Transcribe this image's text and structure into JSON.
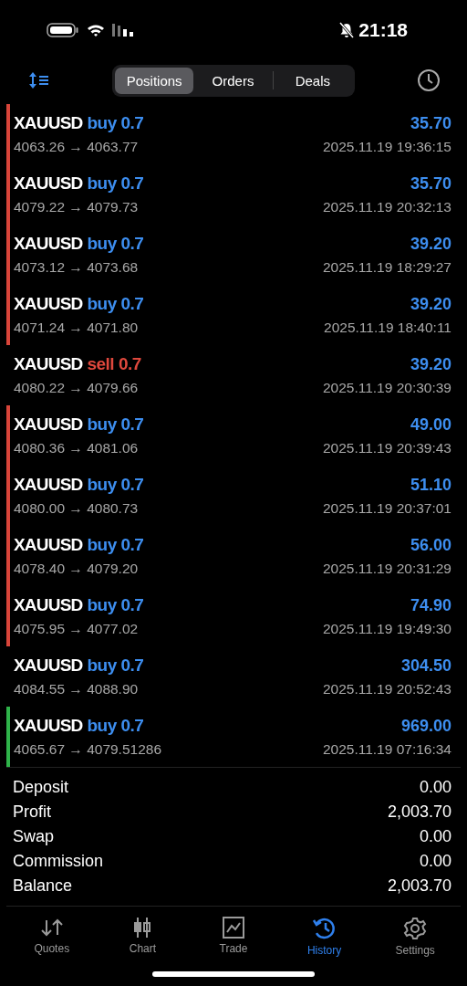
{
  "status_bar": {
    "time": "21:18",
    "muted": true
  },
  "tabs": [
    {
      "label": "Positions",
      "selected": true
    },
    {
      "label": "Orders",
      "selected": false
    },
    {
      "label": "Deals",
      "selected": false
    }
  ],
  "deals": [
    {
      "symbol": "XAUUSD",
      "kind": "buy",
      "volume_text": "buy 0.7",
      "prices": "4063.26 → 4063.77",
      "profit": "35.70",
      "time": "2025.11.19 19:36:15",
      "color": "#d8453a"
    },
    {
      "symbol": "XAUUSD",
      "kind": "buy",
      "volume_text": "buy 0.7",
      "prices": "4079.22 → 4079.73",
      "profit": "35.70",
      "time": "2025.11.19 20:32:13",
      "color": "#d8453a"
    },
    {
      "symbol": "XAUUSD",
      "kind": "buy",
      "volume_text": "buy 0.7",
      "prices": "4073.12 → 4073.68",
      "profit": "39.20",
      "time": "2025.11.19 18:29:27",
      "color": "#d8453a"
    },
    {
      "symbol": "XAUUSD",
      "kind": "buy",
      "volume_text": "buy 0.7",
      "prices": "4071.24 → 4071.80",
      "profit": "39.20",
      "time": "2025.11.19 18:40:11",
      "color": "#d8453a"
    },
    {
      "symbol": "XAUUSD",
      "kind": "sell",
      "volume_text": "sell 0.7",
      "prices": "4080.22 → 4079.66",
      "profit": "39.20",
      "time": "2025.11.19 20:30:39"
    },
    {
      "symbol": "XAUUSD",
      "kind": "buy",
      "volume_text": "buy 0.7",
      "prices": "4080.36 → 4081.06",
      "profit": "49.00",
      "time": "2025.11.19 20:39:43",
      "color": "#d8453a"
    },
    {
      "symbol": "XAUUSD",
      "kind": "buy",
      "volume_text": "buy 0.7",
      "prices": "4080.00 → 4080.73",
      "profit": "51.10",
      "time": "2025.11.19 20:37:01",
      "color": "#d8453a"
    },
    {
      "symbol": "XAUUSD",
      "kind": "buy",
      "volume_text": "buy 0.7",
      "prices": "4078.40 → 4079.20",
      "profit": "56.00",
      "time": "2025.11.19 20:31:29",
      "color": "#d8453a"
    },
    {
      "symbol": "XAUUSD",
      "kind": "buy",
      "volume_text": "buy 0.7",
      "prices": "4075.95 → 4077.02",
      "profit": "74.90",
      "time": "2025.11.19 19:49:30",
      "color": "#d8453a"
    },
    {
      "symbol": "XAUUSD",
      "kind": "buy",
      "volume_text": "buy 0.7",
      "prices": "4084.55 → 4088.90",
      "profit": "304.50",
      "time": "2025.11.19 20:52:43"
    },
    {
      "symbol": "XAUUSD",
      "kind": "buy",
      "volume_text": "buy 0.7",
      "prices": "4065.67 → 4079.51286",
      "profit": "969.00",
      "time": "2025.11.19 07:16:34",
      "color": "#2fb34a"
    }
  ],
  "summary": [
    {
      "label": "Deposit",
      "value": "0.00"
    },
    {
      "label": "Profit",
      "value": "2,003.70"
    },
    {
      "label": "Swap",
      "value": "0.00"
    },
    {
      "label": "Commission",
      "value": "0.00"
    },
    {
      "label": "Balance",
      "value": "2,003.70"
    }
  ],
  "bottom_nav": [
    {
      "label": "Quotes",
      "kind": "quotes",
      "selected": false
    },
    {
      "label": "Chart",
      "kind": "chart",
      "selected": false
    },
    {
      "label": "Trade",
      "kind": "trade",
      "selected": false
    },
    {
      "label": "History",
      "kind": "history",
      "selected": true
    },
    {
      "label": "Settings",
      "kind": "settings",
      "selected": false
    }
  ]
}
